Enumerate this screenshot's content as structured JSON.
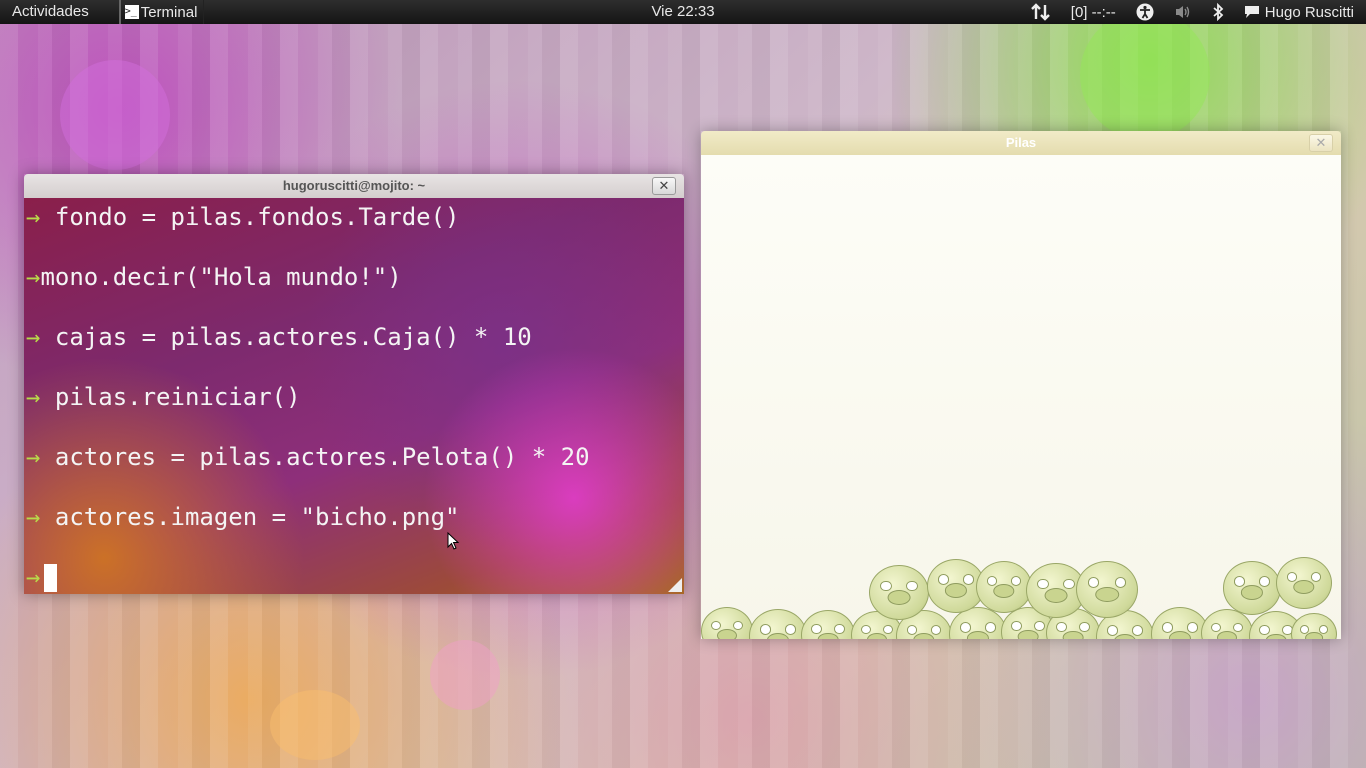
{
  "panel": {
    "activities": "Actividades",
    "app_name": "Terminal",
    "app_icon_glyph": ">_",
    "clock": "Vie 22:33",
    "battery": "[0] --:--",
    "user": "Hugo Ruscitti",
    "tray_icons": [
      "network-icon",
      "battery-status",
      "accessibility-icon",
      "volume-icon",
      "bluetooth-icon",
      "chat-icon"
    ]
  },
  "terminal": {
    "title": "hugoruscitti@mojito: ~",
    "close_glyph": "✕",
    "prompt_glyph": "→",
    "lines": [
      "fondo = pilas.fondos.Tarde()",
      "mono.decir(\"Hola mundo!\")",
      "cajas = pilas.actores.Caja() * 10",
      "pilas.reiniciar()",
      "actores = pilas.actores.Pelota() * 20",
      "actores.imagen = \"bicho.png\""
    ]
  },
  "pilas": {
    "title": "Pilas",
    "close_glyph": "✕"
  },
  "colors": {
    "panel_bg": "#1c1c1c",
    "prompt_arrow": "#b8d94a",
    "pig_green": "#cfd99a"
  }
}
